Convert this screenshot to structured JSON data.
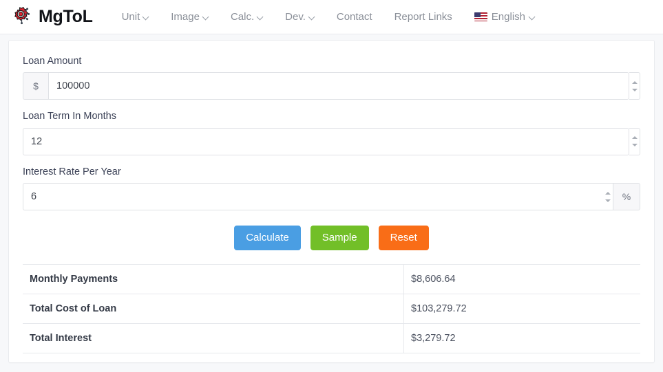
{
  "navbar": {
    "brand": "MgToL",
    "logo_icon": "gear-circuit-logo",
    "items": [
      {
        "label": "Unit",
        "has_dropdown": true
      },
      {
        "label": "Image",
        "has_dropdown": true
      },
      {
        "label": "Calc.",
        "has_dropdown": true
      },
      {
        "label": "Dev.",
        "has_dropdown": true
      },
      {
        "label": "Contact",
        "has_dropdown": false
      },
      {
        "label": "Report Links",
        "has_dropdown": false
      }
    ],
    "language": {
      "label": "English",
      "flag_icon": "us-flag-icon",
      "has_dropdown": true
    }
  },
  "form": {
    "fields": [
      {
        "label": "Loan Amount",
        "prefix": "$",
        "suffix": "",
        "value": "100000",
        "placeholder": "Loan Amount"
      },
      {
        "label": "Loan Term In Months",
        "prefix": "",
        "suffix": "",
        "value": "12",
        "placeholder": "Loan Term In Months"
      },
      {
        "label": "Interest Rate Per Year",
        "prefix": "",
        "suffix": "%",
        "value": "6",
        "placeholder": "Interest Rate Per Year"
      }
    ],
    "buttons": [
      {
        "label": "Calculate",
        "color": "#4a9ee3"
      },
      {
        "label": "Sample",
        "color": "#72bf28"
      },
      {
        "label": "Reset",
        "color": "#f96d17"
      }
    ]
  },
  "results": {
    "rows": [
      {
        "label": "Monthly Payments",
        "value": "$8,606.64"
      },
      {
        "label": "Total Cost of Loan",
        "value": "$103,279.72"
      },
      {
        "label": "Total Interest",
        "value": "$3,279.72"
      }
    ]
  },
  "colors": {
    "page_bg": "#f7f8fa",
    "card_bg": "#ffffff",
    "border": "#e6e8ec",
    "text": "#3c4257",
    "nav_text": "#8a8f98",
    "accent_blue": "#4a9ee3",
    "accent_green": "#72bf28",
    "accent_orange": "#f96d17",
    "logo_red": "#e0232e"
  }
}
